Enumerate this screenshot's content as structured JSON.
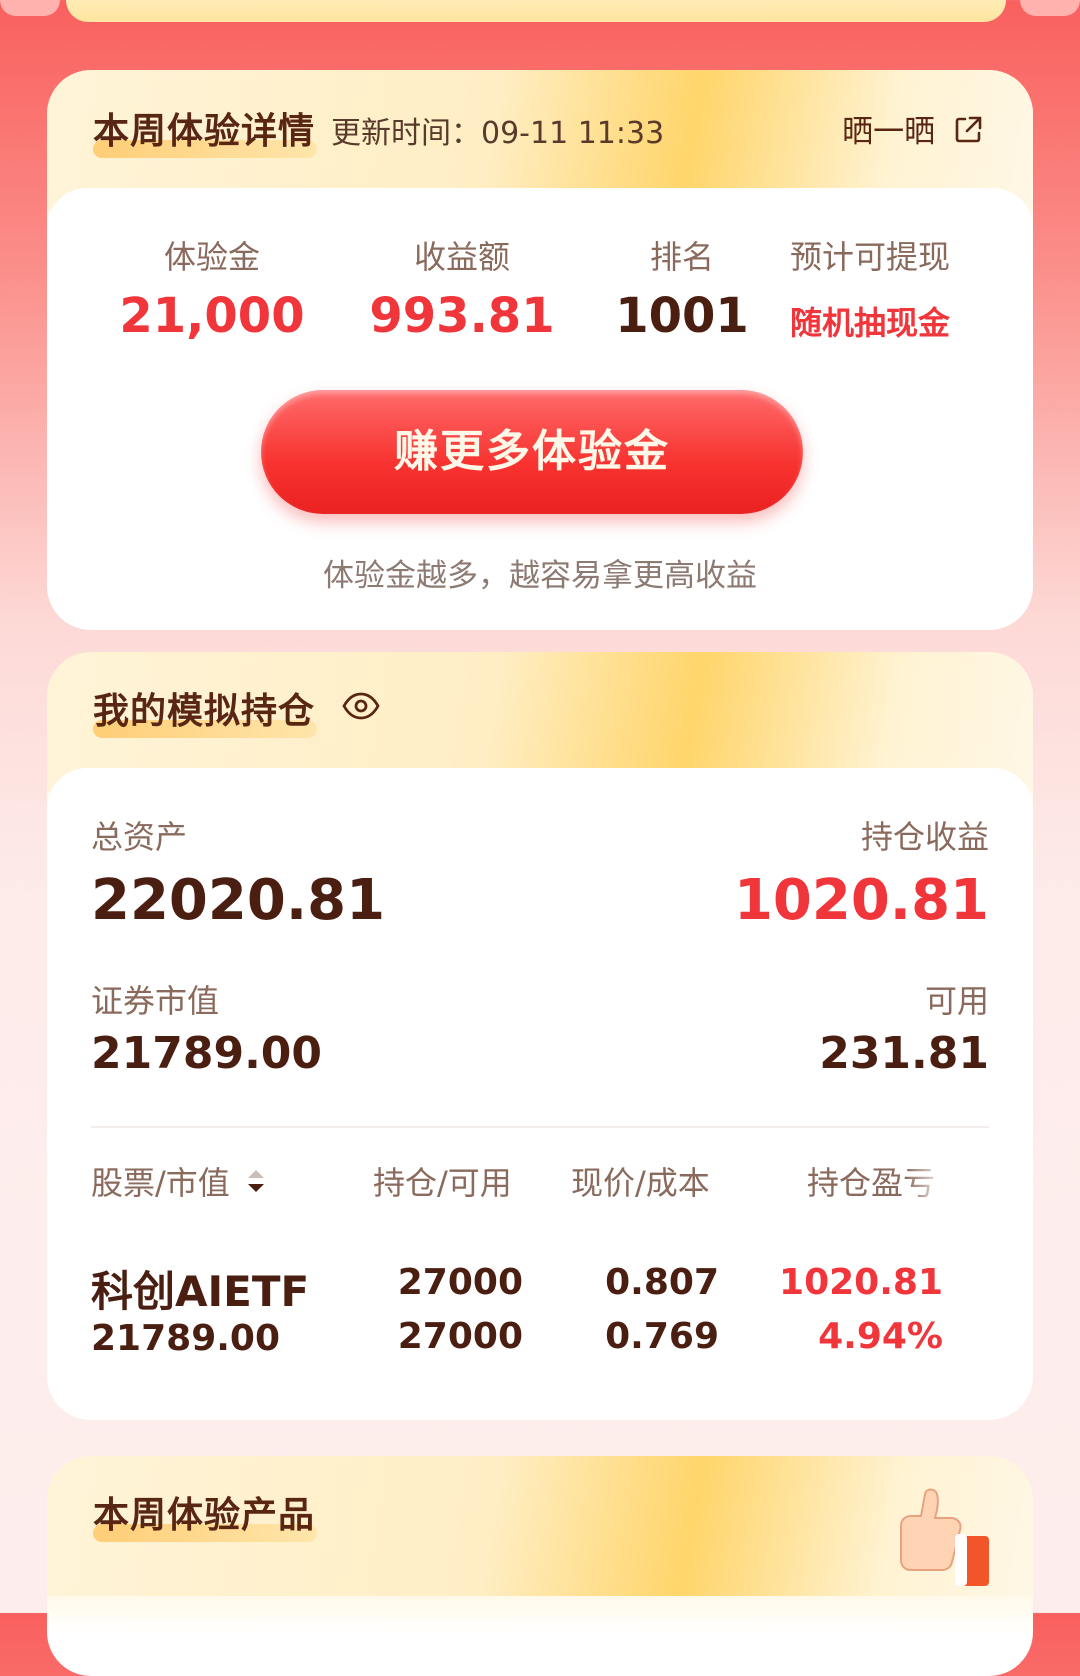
{
  "card1": {
    "title": "本周体验详情",
    "update_prefix": "更新时间：",
    "update_time": "09-11 11:33",
    "share_label": "晒一晒",
    "stats": [
      {
        "label": "体验金",
        "value": "21,000"
      },
      {
        "label": "收益额",
        "value": "993.81"
      },
      {
        "label": "排名",
        "value": "1001"
      },
      {
        "label": "预计可提现",
        "value": "随机抽现金"
      }
    ],
    "button_label": "赚更多体验金",
    "tip": "体验金越多，越容易拿更高收益"
  },
  "card2": {
    "title": "我的模拟持仓",
    "total_assets_label": "总资产",
    "total_assets": "22020.81",
    "holding_profit_label": "持仓收益",
    "holding_profit": "1020.81",
    "market_value_label": "证券市值",
    "market_value": "21789.00",
    "available_label": "可用",
    "available": "231.81",
    "columns": [
      "股票/市值",
      "持仓/可用",
      "现价/成本",
      "持仓盈亏"
    ],
    "rows": [
      {
        "name": "科创AIETF",
        "value": "21789.00",
        "holding": "27000",
        "available": "27000",
        "price": "0.807",
        "cost": "0.769",
        "pnl": "1020.81",
        "pnl_pct": "4.94%"
      }
    ]
  },
  "card3": {
    "title": "本周体验产品"
  },
  "colors": {
    "accent_red": "#f0353b",
    "text_dark": "#4a1f12",
    "muted": "#8a6a5c"
  }
}
